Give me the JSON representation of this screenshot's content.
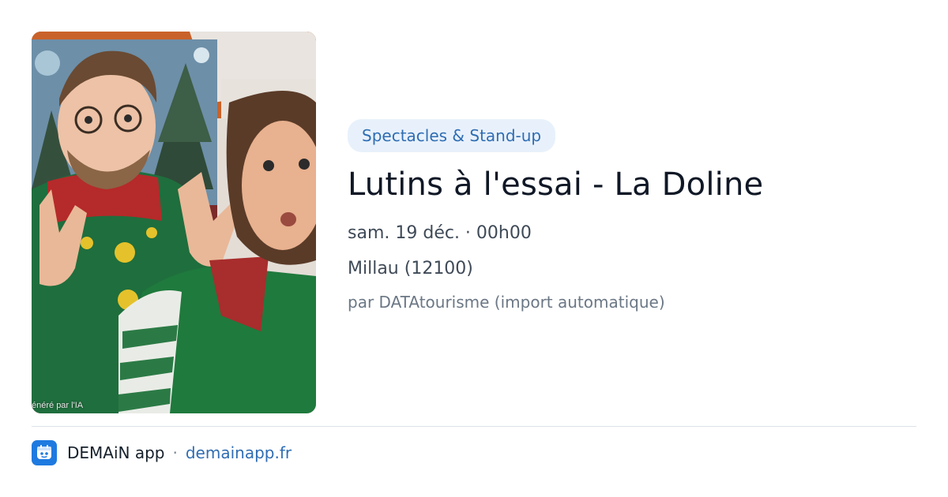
{
  "event": {
    "category": "Spectacles & Stand-up",
    "title": "Lutins à l'essai - La Doline",
    "datetime": "sam. 19 déc. · 00h00",
    "location": "Millau (12100)",
    "source": "par DATAtourisme (import automatique)"
  },
  "image": {
    "credit": "énéré par l'IA",
    "alt": "Lutins à l'essai - La Doline"
  },
  "footer": {
    "app_name": "DEMAiN app",
    "separator": "·",
    "url": "demainapp.fr",
    "icon": "demain-app-icon"
  },
  "colors": {
    "accent": "#2f6db3",
    "badge_bg": "#e8f1fb",
    "app_icon": "#1f7ae0"
  }
}
